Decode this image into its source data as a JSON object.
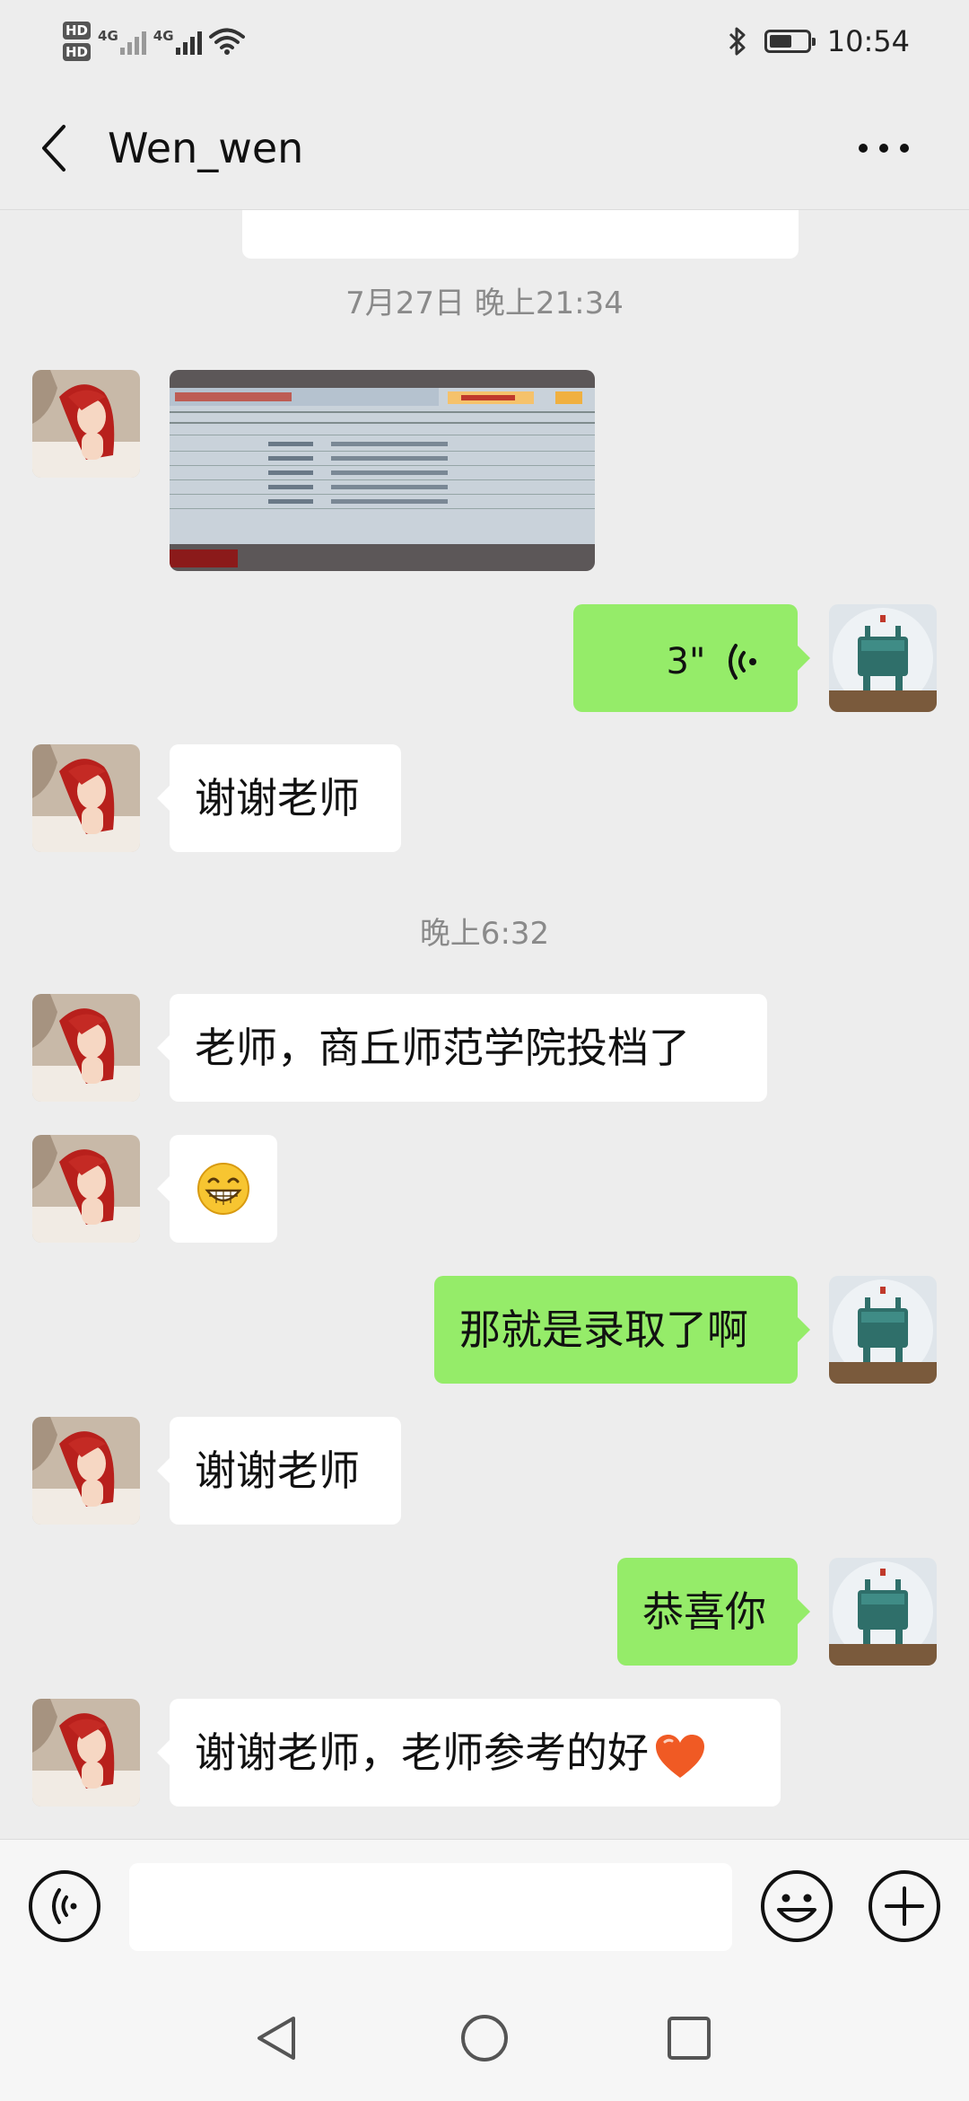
{
  "status_bar": {
    "time": "10:54",
    "sim1_label": "HD",
    "sim1_network": "4G",
    "sim2_label": "HD",
    "sim2_network": "4G",
    "battery_level": 0.6,
    "icons": [
      "hd-icon",
      "signal-icon",
      "wifi-icon",
      "bluetooth-icon",
      "battery-icon"
    ]
  },
  "header": {
    "title": "Wen_wen",
    "back_icon": "chevron-left-icon",
    "more_icon": "more-dots-icon"
  },
  "chat": {
    "timestamp_1": "7月27日 晚上21:34",
    "timestamp_2": "晚上6:32",
    "messages": [
      {
        "side": "left",
        "type": "image",
        "text": ""
      },
      {
        "side": "right",
        "type": "voice",
        "text": "3\""
      },
      {
        "side": "left",
        "type": "text",
        "text": "谢谢老师"
      },
      {
        "side": "left",
        "type": "text",
        "text": "老师，商丘师范学院投档了"
      },
      {
        "side": "left",
        "type": "emoji",
        "text": ""
      },
      {
        "side": "right",
        "type": "text",
        "text": "那就是录取了啊"
      },
      {
        "side": "left",
        "type": "text",
        "text": "谢谢老师"
      },
      {
        "side": "right",
        "type": "text",
        "text": "恭喜你"
      },
      {
        "side": "left",
        "type": "text",
        "text": "谢谢老师，老师参考的好"
      }
    ]
  },
  "input_bar": {
    "placeholder": "",
    "icons": [
      "voice-mode-icon",
      "emoji-icon",
      "plus-icon"
    ]
  },
  "nav_bar": {
    "icons": [
      "nav-back-icon",
      "nav-home-icon",
      "nav-recent-icon"
    ]
  },
  "colors": {
    "background": "#ededed",
    "bubble_self": "#95ec69",
    "bubble_other": "#ffffff",
    "timestamp": "#8a8a8a"
  }
}
